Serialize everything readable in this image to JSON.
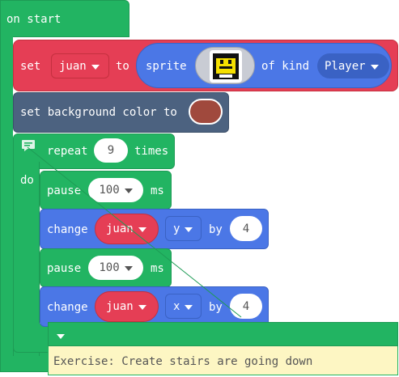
{
  "on_start": {
    "label": "on start"
  },
  "set_sprite": {
    "set_label": "set",
    "variable": "juan",
    "to_label": "to",
    "sprite_label": "sprite",
    "of_kind_label": "of kind",
    "kind": "Player"
  },
  "set_background": {
    "label": "set background color to",
    "color": "#a0493d"
  },
  "repeat": {
    "label": "repeat",
    "count": "9",
    "times_label": "times",
    "do_label": "do"
  },
  "pause_1": {
    "label": "pause",
    "value": "100",
    "unit": "ms"
  },
  "change_1": {
    "label": "change",
    "variable": "juan",
    "axis": "y",
    "by_label": "by",
    "value": "4"
  },
  "pause_2": {
    "label": "pause",
    "value": "100",
    "unit": "ms"
  },
  "change_2": {
    "label": "change",
    "variable": "juan",
    "axis": "x",
    "by_label": "by",
    "value": "4"
  },
  "comment": {
    "text": "Exercise: Create stairs are going down"
  },
  "colors": {
    "green": "#22b462",
    "red": "#e53e55",
    "blue": "#4b77e6",
    "slate": "#4c6280",
    "comment_bg": "#fdf6c3"
  }
}
